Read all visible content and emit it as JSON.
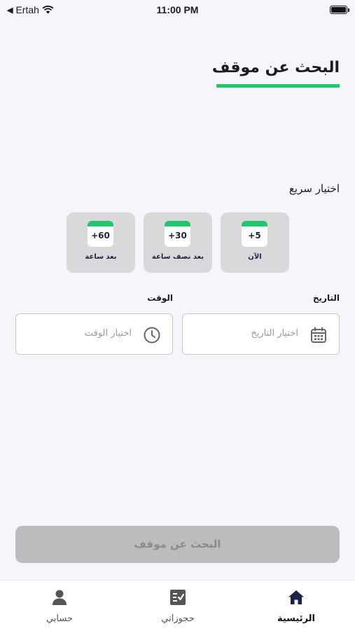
{
  "status_bar": {
    "carrier": "Ertah",
    "time": "11:00 PM"
  },
  "header": {
    "title": "البحث عن موقف"
  },
  "quick_select": {
    "label": "اختيار سريع",
    "options": [
      {
        "badge": "+5",
        "caption": "الآن"
      },
      {
        "badge": "+30",
        "caption": "بعد نصف ساعة"
      },
      {
        "badge": "+60",
        "caption": "بعد ساعة"
      }
    ]
  },
  "date_field": {
    "label": "التاريخ",
    "placeholder": "اختيار التاريخ",
    "icon": "calendar-icon"
  },
  "time_field": {
    "label": "الوقت",
    "placeholder": "اختيار الوقت",
    "icon": "clock-icon"
  },
  "search_button": {
    "label": "البحث عن موقف",
    "enabled": false
  },
  "tab_bar": {
    "tabs": [
      {
        "label": "الرئيسية",
        "icon": "home-icon",
        "active": true
      },
      {
        "label": "حجوزاتي",
        "icon": "bookings-icon",
        "active": false
      },
      {
        "label": "حسابي",
        "icon": "account-icon",
        "active": false
      }
    ]
  },
  "colors": {
    "accent": "#1fc96b",
    "background": "#f5f6fa",
    "card": "#d9d9dc",
    "navy": "#1e2348",
    "disabled_button": "#bcbcbe"
  }
}
